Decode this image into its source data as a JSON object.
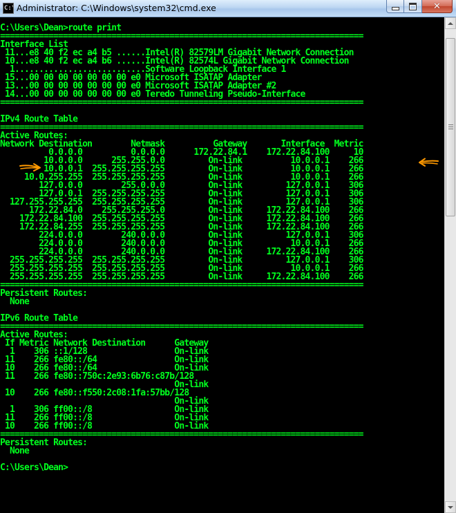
{
  "window": {
    "title": "Administrator: C:\\Windows\\system32\\cmd.exe",
    "icon_text": "C:\\",
    "app_icon": "console-icon",
    "minimize_icon": "minimize-icon",
    "maximize_icon": "maximize-icon",
    "close_icon": "close-icon",
    "close_glyph": "✕"
  },
  "console": {
    "lines": [
      "C:\\Users\\Dean>route print",
      "===========================================================================",
      "Interface List",
      " 11...e8 40 f2 ec a4 b5 ......Intel(R) 82579LM Gigabit Network Connection",
      " 10...e8 40 f2 ec a4 b6 ......Intel(R) 82574L Gigabit Network Connection",
      "  1...........................Software Loopback Interface 1",
      " 15...00 00 00 00 00 00 00 e0 Microsoft ISATAP Adapter",
      " 13...00 00 00 00 00 00 00 e0 Microsoft ISATAP Adapter #2",
      " 14...00 00 00 00 00 00 00 e0 Teredo Tunneling Pseudo-Interface",
      "===========================================================================",
      "",
      "IPv4 Route Table",
      "===========================================================================",
      "Active Routes:",
      "Network Destination        Netmask          Gateway       Interface  Metric",
      "          0.0.0.0          0.0.0.0      172.22.84.1    172.22.84.100     10",
      "         10.0.0.0      255.255.0.0         On-link          10.0.0.1    266",
      "         10.0.0.1  255.255.255.255         On-link          10.0.0.1    266",
      "     10.0.255.255  255.255.255.255         On-link          10.0.0.1    266",
      "        127.0.0.0        255.0.0.0         On-link         127.0.0.1    306",
      "        127.0.0.1  255.255.255.255         On-link         127.0.0.1    306",
      "  127.255.255.255  255.255.255.255         On-link         127.0.0.1    306",
      "      172.22.84.0    255.255.255.0         On-link     172.22.84.100    266",
      "    172.22.84.100  255.255.255.255         On-link     172.22.84.100    266",
      "    172.22.84.255  255.255.255.255         On-link     172.22.84.100    266",
      "        224.0.0.0        240.0.0.0         On-link         127.0.0.1    306",
      "        224.0.0.0        240.0.0.0         On-link          10.0.0.1    266",
      "        224.0.0.0        240.0.0.0         On-link     172.22.84.100    266",
      "  255.255.255.255  255.255.255.255         On-link         127.0.0.1    306",
      "  255.255.255.255  255.255.255.255         On-link          10.0.0.1    266",
      "  255.255.255.255  255.255.255.255         On-link     172.22.84.100    266",
      "===========================================================================",
      "Persistent Routes:",
      "  None",
      "",
      "IPv6 Route Table",
      "===========================================================================",
      "Active Routes:",
      " If Metric Network Destination      Gateway",
      "  1    306 ::1/128                  On-link",
      " 11    266 fe80::/64                On-link",
      " 10    266 fe80::/64                On-link",
      " 11    266 fe80::750c:2e93:6b76:c87b/128",
      "                                    On-link",
      " 10    266 fe80::f550:2c08:1fa:57bb/128",
      "                                    On-link",
      "  1    306 ff00::/8                 On-link",
      " 11    266 ff00::/8                 On-link",
      " 10    266 ff00::/8                 On-link",
      "===========================================================================",
      "Persistent Routes:",
      "  None",
      "",
      "C:\\Users\\Dean>"
    ]
  },
  "annotations": {
    "color": "#ff9900",
    "left_arrow_icon": "right-pointing-arrow-icon",
    "right_arrow_icon": "left-pointing-arrow-icon"
  },
  "scrollbar": {
    "up_icon": "scroll-up-arrow-icon",
    "down_icon": "scroll-down-arrow-icon"
  }
}
